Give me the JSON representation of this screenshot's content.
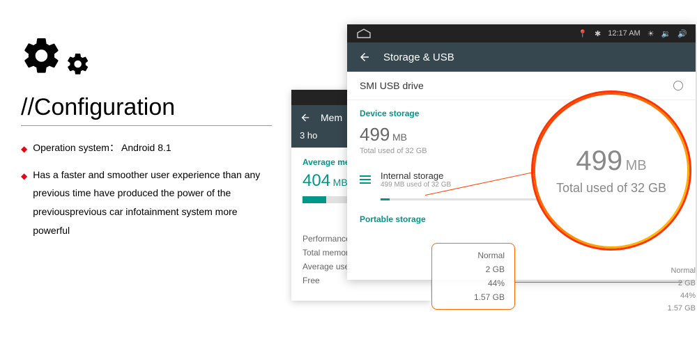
{
  "left": {
    "title": "//Configuration",
    "bullets": [
      "Operation system：  Android 8.1",
      "Has a faster and smoother user experience than any previous time have produced the power of the previousprevious car infotainment system more powerful"
    ]
  },
  "memoryPanel": {
    "headerTitle": "Mem",
    "subHeader": "3 ho",
    "avgLabel": "Average memo",
    "value": "404",
    "unit": "MB",
    "stats": {
      "performance": {
        "label": "Performance",
        "value": ""
      },
      "totalMemory": {
        "label": "Total memory",
        "value": ""
      },
      "avgUsed": {
        "label": "Average used (%)",
        "value": ""
      },
      "free": {
        "label": "Free",
        "value": ""
      }
    }
  },
  "storagePanel": {
    "statusTime": "12:17 AM",
    "headerTitle": "Storage & USB",
    "usbLabel": "SMI USB drive",
    "deviceStorageLabel": "Device storage",
    "deviceValue": "499",
    "deviceUnit": "MB",
    "deviceSub": "Total used of  32 GB",
    "internalLabel": "Internal storage",
    "internalSub": "499 MB used of 32 GB",
    "portableLabel": "Portable storage"
  },
  "magnify": {
    "value": "499",
    "unit": "MB",
    "sub": "Total used of  32 GB"
  },
  "callout": {
    "r1": "Normal",
    "r2": "2 GB",
    "r3": "44%",
    "r4": "1.57 GB"
  },
  "statsRight": {
    "r1": "Normal",
    "r2": "2 GB",
    "r3": "44%",
    "r4": "1.57 GB"
  }
}
